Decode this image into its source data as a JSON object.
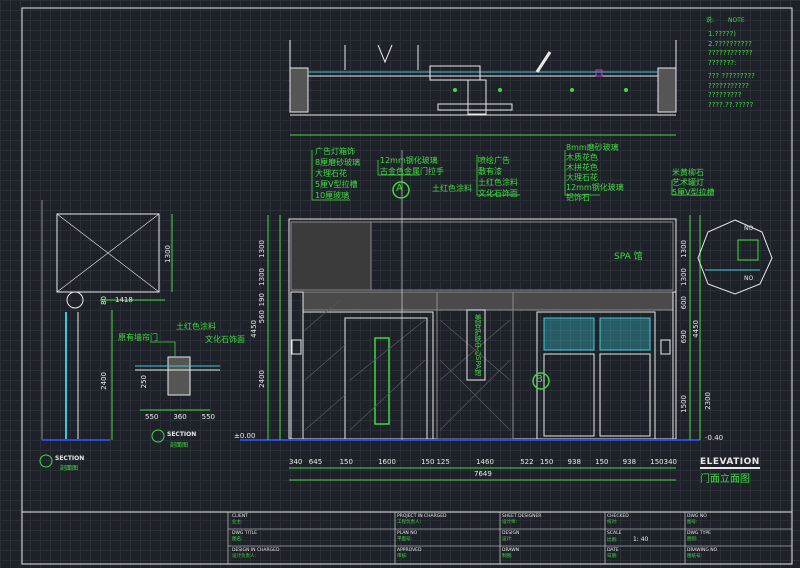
{
  "colors": {
    "background": "#1e2228",
    "grid": "#2a2f37",
    "green": "#3cdc3c",
    "white": "#e8e8e8",
    "cyan": "#3cc8d8",
    "yellow": "#d8d23c",
    "gray": "#8a8a8a",
    "blue": "#2a4cd8",
    "magenta": "#c83cc8"
  },
  "notes": {
    "header_left": "说:",
    "header_right": "NOTE",
    "lines": [
      "1.?????)",
      "2.??????????",
      "????????????",
      "???????​:",
      "??? ?????????",
      "???????????",
      "?????????",
      "????.??.?????"
    ]
  },
  "callouts_left": [
    "广告灯箱饰",
    "8厘磨砂玻璃",
    "大理石花",
    "5厘V型拉槽",
    "10厘玻璃"
  ],
  "callouts_mid": [
    "12mm钢化玻璃",
    "古金色金属门拉手"
  ],
  "callouts_center": [
    "喷绘广告",
    "敷有漆",
    "土红色涂料",
    "文化石饰面"
  ],
  "callouts_center_left": "土红色涂料",
  "callouts_right": [
    "8mm磨砂玻璃",
    "木质花色",
    "木拼花色",
    "大理石花",
    "12mm钢化玻璃",
    "铝饰石"
  ],
  "callouts_far_right": [
    "米黄柳石",
    "艺术罐灯",
    "5厘V型拉槽"
  ],
  "section_callouts": [
    "原有墙帘门",
    "土红色涂料",
    "文化石饰面"
  ],
  "spa_sign": "SPA 馆",
  "vertical_sign": "美容护肤中心SPA馆",
  "marker_a": "A",
  "marker_b": "B",
  "left_dims_vertical": [
    "1300",
    "1300",
    "190",
    "560",
    "2400",
    "4450"
  ],
  "right_dims_vertical": [
    "1300",
    "1300",
    "600",
    "690",
    "1500",
    "4450",
    "2300"
  ],
  "bottom_dims": [
    "340",
    "645",
    "150",
    "1600",
    "150",
    "125",
    "1460",
    "522",
    "150",
    "938",
    "150",
    "938",
    "150",
    "340"
  ],
  "bottom_total": "7649",
  "level_left": "±0.00",
  "level_right": "-0.40",
  "section_dims": [
    "550",
    "360",
    "550"
  ],
  "section_dim_v": "250",
  "left_section_dims": [
    "1418",
    "80",
    "2400",
    "1300"
  ],
  "elevation_title": "ELEVATION",
  "elevation_subtitle": "门面立面图",
  "section_a_title": "SECTION",
  "section_a_sub": "剖面图",
  "section_b_title": "SECTION",
  "section_b_sub": "剖面图",
  "detail_dims": [
    "NO",
    "NO"
  ],
  "title_block": {
    "cells": [
      {
        "label": "CLIENT",
        "value": "业主:"
      },
      {
        "label": "PROJECT IN CHARGED",
        "value": "工程负责人:"
      },
      {
        "label": "SHEET DESIGNER",
        "value": "设计师:"
      },
      {
        "label": "CHECKED",
        "value": "校对:"
      },
      {
        "label": "DWG NO",
        "value": "图号:"
      },
      {
        "label": "DWG TITLE",
        "value": "图名:"
      },
      {
        "label": "PLAN NO",
        "value": "平面号:"
      },
      {
        "label": "DESIGN",
        "value": "设计:"
      },
      {
        "label": "SCALE",
        "value": "比例:",
        "extra": "1: 40"
      },
      {
        "label": "DWG TYPE",
        "value": "图别:"
      },
      {
        "label": "DESIGN IN CHARGED",
        "value": "设计负责人:"
      },
      {
        "label": "APPROVED",
        "value": "审核:"
      },
      {
        "label": "DRAWN",
        "value": "制图:"
      },
      {
        "label": "DATE",
        "value": "日期:"
      },
      {
        "label": "DRAWING NO",
        "value": "图纸号:"
      }
    ]
  }
}
